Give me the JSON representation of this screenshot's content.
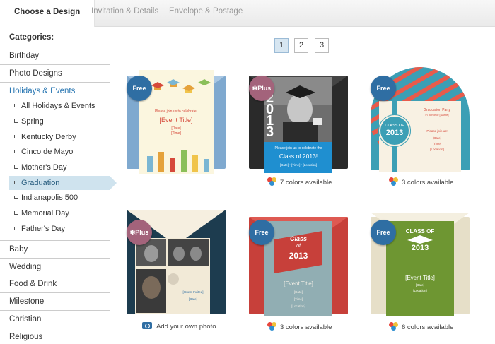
{
  "tabs": [
    {
      "label": "Choose a Design"
    },
    {
      "label": "Invitation & Details"
    },
    {
      "label": "Envelope & Postage"
    }
  ],
  "sidebar": {
    "heading": "Categories:",
    "top_items": [
      {
        "label": "Birthday"
      },
      {
        "label": "Photo Designs"
      },
      {
        "label": "Holidays & Events"
      }
    ],
    "sub_items": [
      {
        "label": "All Holidays & Events"
      },
      {
        "label": "Spring"
      },
      {
        "label": "Kentucky Derby"
      },
      {
        "label": "Cinco de Mayo"
      },
      {
        "label": "Mother's Day"
      },
      {
        "label": "Graduation"
      },
      {
        "label": "Indianapolis 500"
      },
      {
        "label": "Memorial Day"
      },
      {
        "label": "Father's Day"
      }
    ],
    "bottom_items": [
      {
        "label": "Baby"
      },
      {
        "label": "Wedding"
      },
      {
        "label": "Food & Drink"
      },
      {
        "label": "Milestone"
      },
      {
        "label": "Christian"
      },
      {
        "label": "Religious"
      }
    ]
  },
  "pagination": {
    "pages": [
      "1",
      "2",
      "3"
    ],
    "current": "1"
  },
  "cards": [
    {
      "badge": "Free",
      "info": "",
      "lines": [
        "Please join us to celebrate!",
        "[Event Title]",
        "[Date]",
        "[Time]"
      ]
    },
    {
      "badge": "Plus",
      "info": "7 colors available",
      "lines": [
        "2013",
        "Please join us to celebrate the",
        "Class of 2013!",
        "[Date] • [Time] • [Location]"
      ]
    },
    {
      "badge": "Free",
      "info": "3 colors available",
      "lines": [
        "CLASS OF",
        "2013",
        "Graduation Party",
        "in honor of [Name]",
        "Please join us!",
        "[Date]",
        "[Time]",
        "[Location]"
      ]
    },
    {
      "badge": "Plus",
      "info": "Add your own photo",
      "lines": [
        "[Guest Invited]",
        "[Date]"
      ]
    },
    {
      "badge": "Free",
      "info": "3 colors available",
      "lines": [
        "Class",
        "of",
        "2013",
        "[Event Title]",
        "[Date]",
        "[Time]",
        "[Location]"
      ]
    },
    {
      "badge": "Free",
      "info": "6 colors available",
      "lines": [
        "CLASS OF",
        "2013",
        "[Event Title]",
        "[Date]",
        "[Location]"
      ]
    }
  ],
  "colors": {
    "accent_blue": "#2f6ea3",
    "plus_badge": "#a3637b",
    "selected_bg": "#cfe3ee"
  }
}
